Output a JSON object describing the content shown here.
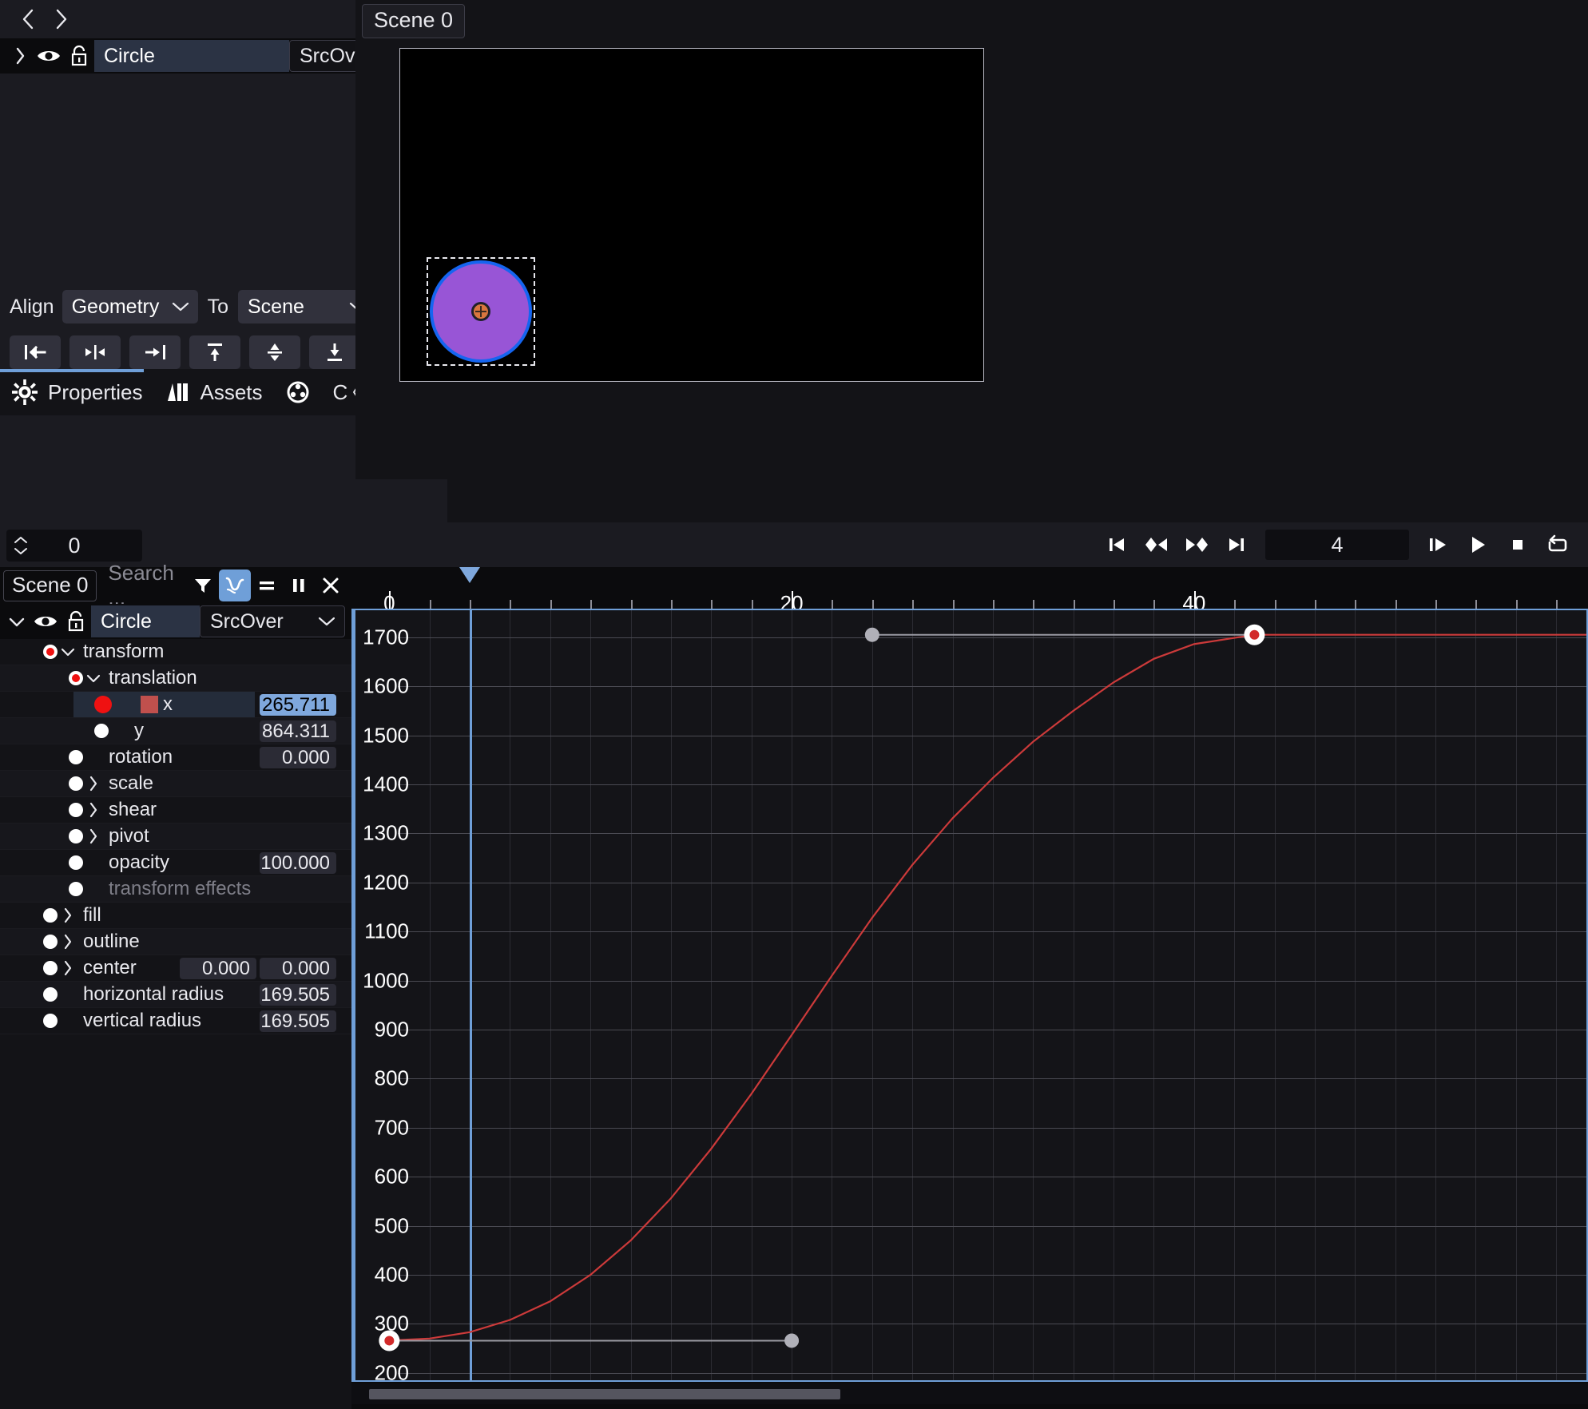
{
  "left_panel": {
    "nav": {
      "back_icon": "chevron-left-icon",
      "forward_icon": "chevron-right-icon",
      "up_icon": "chevron-up-icon",
      "down_icon": "chevron-down-icon"
    },
    "layer": {
      "expand_icon": "chevron-right-icon",
      "visibility_icon": "eye-icon",
      "lock_icon": "unlock-icon",
      "name": "Circle",
      "blend_mode": "SrcOver",
      "blend_modes": [
        "SrcOver"
      ],
      "blend_dropdown_icon": "chevron-down-icon"
    },
    "align": {
      "label": "Align",
      "mode": "Geometry",
      "mode_options": [
        "Geometry"
      ],
      "to_label": "To",
      "target": "Scene",
      "target_options": [
        "Scene"
      ],
      "buttons": [
        {
          "name": "align-left",
          "icon": "align-left-icon"
        },
        {
          "name": "align-horizontal-center",
          "icon": "align-hcenter-icon"
        },
        {
          "name": "align-right",
          "icon": "align-right-icon"
        },
        {
          "name": "align-top",
          "icon": "align-top-icon"
        },
        {
          "name": "align-vertical-center",
          "icon": "align-vcenter-icon"
        },
        {
          "name": "align-bottom",
          "icon": "align-bottom-icon"
        }
      ]
    },
    "tabs": [
      {
        "label": "Properties",
        "icon": "gear-icon",
        "active": true
      },
      {
        "label": "Assets",
        "icon": "library-icon",
        "active": false
      },
      {
        "label": "",
        "icon": "film-reel-icon",
        "active": false
      },
      {
        "label": "C",
        "icon": "",
        "active": false
      }
    ],
    "tab_nav": {
      "prev_icon": "chevron-left-icon",
      "next_icon": "chevron-right-icon"
    }
  },
  "viewport": {
    "scene_tab": "Scene 0",
    "shape": {
      "name": "circle-shape",
      "fill_color": "#9855d6",
      "outline_color": "#1565f0",
      "pivot_color": "#d9763f",
      "selection": "dashed"
    }
  },
  "transport": {
    "frame_spinner_value": "0",
    "current_frame": "4",
    "buttons": [
      {
        "name": "go-to-start-button",
        "icon": "skip-to-start-icon"
      },
      {
        "name": "previous-keyframe-button",
        "icon": "prev-keyframe-icon"
      },
      {
        "name": "next-keyframe-button",
        "icon": "next-keyframe-icon"
      },
      {
        "name": "go-to-end-button",
        "icon": "skip-to-end-icon"
      },
      {
        "name": "step-forward-button",
        "icon": "step-forward-icon"
      },
      {
        "name": "play-button",
        "icon": "play-icon"
      },
      {
        "name": "stop-button",
        "icon": "stop-icon"
      },
      {
        "name": "loop-button",
        "icon": "loop-icon"
      }
    ]
  },
  "timeline_toolbar": {
    "scene_chip": "Scene 0",
    "search_placeholder": "Search ...",
    "buttons": [
      {
        "name": "filter-button",
        "icon": "funnel-icon",
        "active": false
      },
      {
        "name": "curve-editor-button",
        "icon": "curve-icon",
        "active": true
      },
      {
        "name": "dope-sheet-button",
        "icon": "equals-icon",
        "active": false
      },
      {
        "name": "pause-button",
        "icon": "pause-icon",
        "active": false
      },
      {
        "name": "close-button",
        "icon": "close-icon",
        "active": false
      }
    ]
  },
  "tree": {
    "header": {
      "expand_icon": "chevron-down-icon",
      "visibility_icon": "eye-icon",
      "lock_icon": "unlock-icon",
      "name": "Circle",
      "blend_mode": "SrcOver"
    },
    "rows": [
      {
        "label": "transform",
        "indent": 1,
        "twisty": "down",
        "dot": "ring",
        "values": []
      },
      {
        "label": "translation",
        "indent": 2,
        "twisty": "down",
        "dot": "ring",
        "values": []
      },
      {
        "label": "x",
        "indent": 3,
        "twisty": "none",
        "dot": "red",
        "swatch": "#c0504d",
        "values": [
          "265.711"
        ],
        "selected": true
      },
      {
        "label": "y",
        "indent": 3,
        "twisty": "none",
        "dot": "plain",
        "values": [
          "864.311"
        ]
      },
      {
        "label": "rotation",
        "indent": 2,
        "twisty": "none",
        "dot": "plain",
        "values": [
          "0.000"
        ]
      },
      {
        "label": "scale",
        "indent": 2,
        "twisty": "right",
        "dot": "plain",
        "values": []
      },
      {
        "label": "shear",
        "indent": 2,
        "twisty": "right",
        "dot": "plain",
        "values": []
      },
      {
        "label": "pivot",
        "indent": 2,
        "twisty": "right",
        "dot": "plain",
        "values": []
      },
      {
        "label": "opacity",
        "indent": 2,
        "twisty": "none",
        "dot": "plain",
        "values": [
          "100.000"
        ]
      },
      {
        "label": "transform effects",
        "indent": 2,
        "twisty": "none",
        "dot": "plain",
        "dim": true,
        "values": []
      },
      {
        "label": "fill",
        "indent": 1,
        "twisty": "right",
        "dot": "plain",
        "values": []
      },
      {
        "label": "outline",
        "indent": 1,
        "twisty": "right",
        "dot": "plain",
        "values": []
      },
      {
        "label": "center",
        "indent": 1,
        "twisty": "right",
        "dot": "plain",
        "values": [
          "0.000",
          "0.000"
        ]
      },
      {
        "label": "horizontal radius",
        "indent": 1,
        "twisty": "none",
        "dot": "plain",
        "values": [
          "169.505"
        ]
      },
      {
        "label": "vertical radius",
        "indent": 1,
        "twisty": "none",
        "dot": "plain",
        "values": [
          "169.505"
        ]
      }
    ]
  },
  "chart_data": {
    "type": "line",
    "title": "",
    "xlabel": "",
    "ylabel": "",
    "property": "translation.x",
    "curve_color": "#cc3a3a",
    "xlim": [
      -1.8,
      59.5
    ],
    "ylim": [
      185,
      1755
    ],
    "x_ticks": [
      0,
      20,
      40
    ],
    "x_tick_labels": [
      "0",
      "20",
      "40"
    ],
    "x_minor_step": 2,
    "y_ticks": [
      200,
      300,
      400,
      500,
      600,
      700,
      800,
      900,
      1000,
      1100,
      1200,
      1300,
      1400,
      1500,
      1600,
      1700
    ],
    "y_tick_labels": [
      "200",
      "300",
      "400",
      "500",
      "600",
      "700",
      "800",
      "900",
      "1000",
      "1100",
      "1200",
      "1300",
      "1400",
      "1500",
      "1600",
      "1700"
    ],
    "grid": true,
    "playhead_frame": 4,
    "keyframes": [
      {
        "frame": 0,
        "value": 265.711,
        "selected": true,
        "out_handle": {
          "frame": 20,
          "value": 265.711
        }
      },
      {
        "frame": 43,
        "value": 1705.0,
        "selected": true,
        "in_handle": {
          "frame": 24,
          "value": 1705.0
        }
      }
    ],
    "curve_samples_x": [
      0,
      2,
      4,
      6,
      8,
      10,
      12,
      14,
      16,
      18,
      20,
      22,
      24,
      26,
      28,
      30,
      32,
      34,
      36,
      38,
      40,
      43,
      60
    ],
    "curve_samples_y": [
      266,
      270,
      283,
      308,
      346,
      400,
      470,
      556,
      657,
      769,
      889,
      1010,
      1128,
      1236,
      1331,
      1413,
      1487,
      1550,
      1608,
      1656,
      1686,
      1705,
      1705
    ]
  }
}
